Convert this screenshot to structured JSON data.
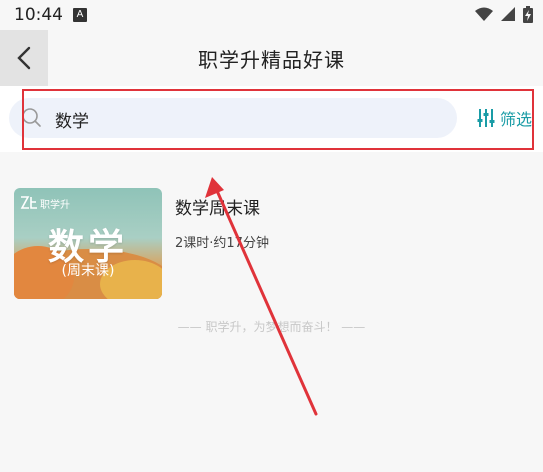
{
  "status_bar": {
    "time": "10:44",
    "notification_badge": "A",
    "icons": [
      "wifi-icon",
      "signal-icon",
      "battery-charging-icon"
    ]
  },
  "nav": {
    "title": "职学升精品好课",
    "back_icon": "chevron-left-icon"
  },
  "search": {
    "value": "数学",
    "icon": "search-icon",
    "filter_label": "筛选",
    "filter_icon": "sliders-icon"
  },
  "course": {
    "title": "数学周末课",
    "meta": "2课时·约17分钟",
    "thumbnail": {
      "brand": "职学升",
      "subject": "数学",
      "subtitle": "(周末课)"
    }
  },
  "footer": {
    "slogan": "—— 职学升，为梦想而奋斗！ ——"
  },
  "colors": {
    "accent": "#1a9ca6",
    "annotation_red": "#e0333a",
    "search_bg": "#eef2fa"
  }
}
